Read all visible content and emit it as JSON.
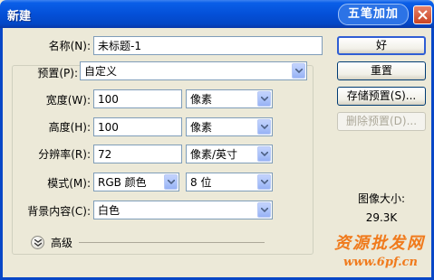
{
  "window": {
    "title": "新建",
    "ime_badge": "五笔加加"
  },
  "form": {
    "name_label": "名称(N):",
    "name_value": "未标题-1",
    "preset_label": "预置(P):",
    "preset_value": "自定义",
    "width_label": "宽度(W):",
    "width_value": "100",
    "width_unit": "像素",
    "height_label": "高度(H):",
    "height_value": "100",
    "height_unit": "像素",
    "resolution_label": "分辨率(R):",
    "resolution_value": "72",
    "resolution_unit": "像素/英寸",
    "mode_label": "模式(M):",
    "mode_value": "RGB 颜色",
    "bit_depth": "8 位",
    "background_label": "背景内容(C):",
    "background_value": "白色",
    "advanced_label": "高级"
  },
  "buttons": {
    "ok": "好",
    "reset": "重置",
    "save_preset": "存储预置(S)...",
    "delete_preset": "删除预置(D)..."
  },
  "image_size": {
    "label": "图像大小:",
    "value": "29.3K"
  },
  "watermark": {
    "line1": "资源批发网",
    "line2": "www.6pf.cn"
  },
  "colors": {
    "title_bar": "#0450d8",
    "dialog_bg": "#ece9d8",
    "watermark": "#f07a1c"
  }
}
